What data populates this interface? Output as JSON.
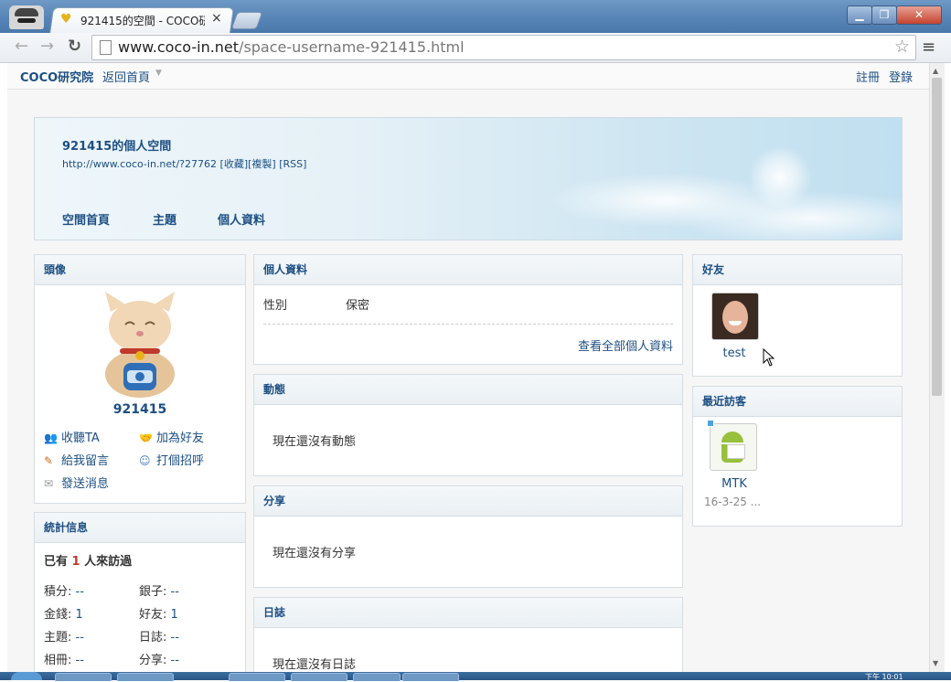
{
  "browser": {
    "tab_title": "921415的空間 - COCO研",
    "tab_close": "×",
    "url_host": "www.coco-in.net",
    "url_path": "/space-username-921415.html",
    "window_controls": {
      "minimize": "▁",
      "maximize": "❐",
      "close": "✕"
    }
  },
  "topbar": {
    "site_name": "COCO研究院",
    "back_home": "返回首頁",
    "register": "註冊",
    "login": "登錄"
  },
  "header": {
    "title": "921415的個人空間",
    "url": "http://www.coco-in.net/?27762",
    "links": [
      "[收藏]",
      "[複製]",
      "[RSS]"
    ],
    "nav": [
      "空間首頁",
      "主題",
      "個人資料"
    ]
  },
  "avatar_panel": {
    "title": "頭像",
    "username": "921415",
    "actions": {
      "follow": "收聽TA",
      "add_friend": "加為好友",
      "leave_message": "給我留言",
      "greet": "打個招呼",
      "send_message": "發送消息"
    }
  },
  "stats_panel": {
    "title": "統計信息",
    "visited_prefix": "已有",
    "visited_count": "1",
    "visited_suffix": "人來訪過",
    "items": [
      {
        "label": "積分:",
        "value": "--"
      },
      {
        "label": "銀子:",
        "value": "--"
      },
      {
        "label": "金錢:",
        "value": "1"
      },
      {
        "label": "好友:",
        "value": "1"
      },
      {
        "label": "主題:",
        "value": "--"
      },
      {
        "label": "日誌:",
        "value": "--"
      },
      {
        "label": "相冊:",
        "value": "--"
      },
      {
        "label": "分享:",
        "value": "--"
      }
    ]
  },
  "profile_panel": {
    "title": "個人資料",
    "gender_label": "性別",
    "gender_value": "保密",
    "view_all": "查看全部個人資料"
  },
  "feed_panel": {
    "title": "動態",
    "empty": "現在還沒有動態"
  },
  "share_panel": {
    "title": "分享",
    "empty": "現在還沒有分享"
  },
  "blog_panel": {
    "title": "日誌",
    "empty": "現在還沒有日誌"
  },
  "friends_panel": {
    "title": "好友",
    "friends": [
      {
        "name": "test"
      }
    ]
  },
  "visitors_panel": {
    "title": "最近訪客",
    "visitors": [
      {
        "name": "MTK",
        "time": "16-3-25 ..."
      }
    ]
  },
  "taskbar": {
    "clock_partial": "下午 10:01"
  }
}
